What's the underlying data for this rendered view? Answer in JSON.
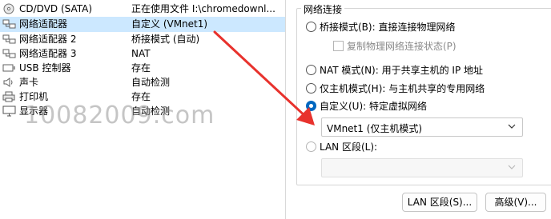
{
  "hardware_list": [
    {
      "icon": "cd-dvd-icon",
      "name": "CD/DVD (SATA)",
      "summary": "正在使用文件 I:\\chromedownl..."
    },
    {
      "icon": "network-adapter-icon",
      "name": "网络适配器",
      "summary": "自定义 (VMnet1)",
      "selected": true
    },
    {
      "icon": "network-adapter-icon",
      "name": "网络适配器 2",
      "summary": "桥接模式 (自动)"
    },
    {
      "icon": "network-adapter-icon",
      "name": "网络适配器 3",
      "summary": "NAT"
    },
    {
      "icon": "usb-controller-icon",
      "name": "USB 控制器",
      "summary": "存在"
    },
    {
      "icon": "sound-card-icon",
      "name": "声卡",
      "summary": "自动检测"
    },
    {
      "icon": "printer-icon",
      "name": "打印机",
      "summary": "存在"
    },
    {
      "icon": "display-icon",
      "name": "显示器",
      "summary": "自动检测"
    }
  ],
  "watermark": "10082009.com",
  "network": {
    "group_title": "网络连接",
    "bridged_label": "桥接模式(B): 直接连接物理网络",
    "replicate_label": "复制物理网络连接状态(P)",
    "nat_label": "NAT 模式(N): 用于共享主机的 IP 地址",
    "hostonly_label": "仅主机模式(H): 与主机共享的专用网络",
    "custom_label": "自定义(U): 特定虚拟网络",
    "custom_select_value": "VMnet1 (仅主机模式)",
    "lan_label": "LAN 区段(L):",
    "lan_select_value": "",
    "selected_mode": "custom"
  },
  "buttons": {
    "lan_segments": "LAN 区段(S)...",
    "advanced": "高级(V)..."
  },
  "annotation": {
    "arrow_color": "#e8322d"
  }
}
